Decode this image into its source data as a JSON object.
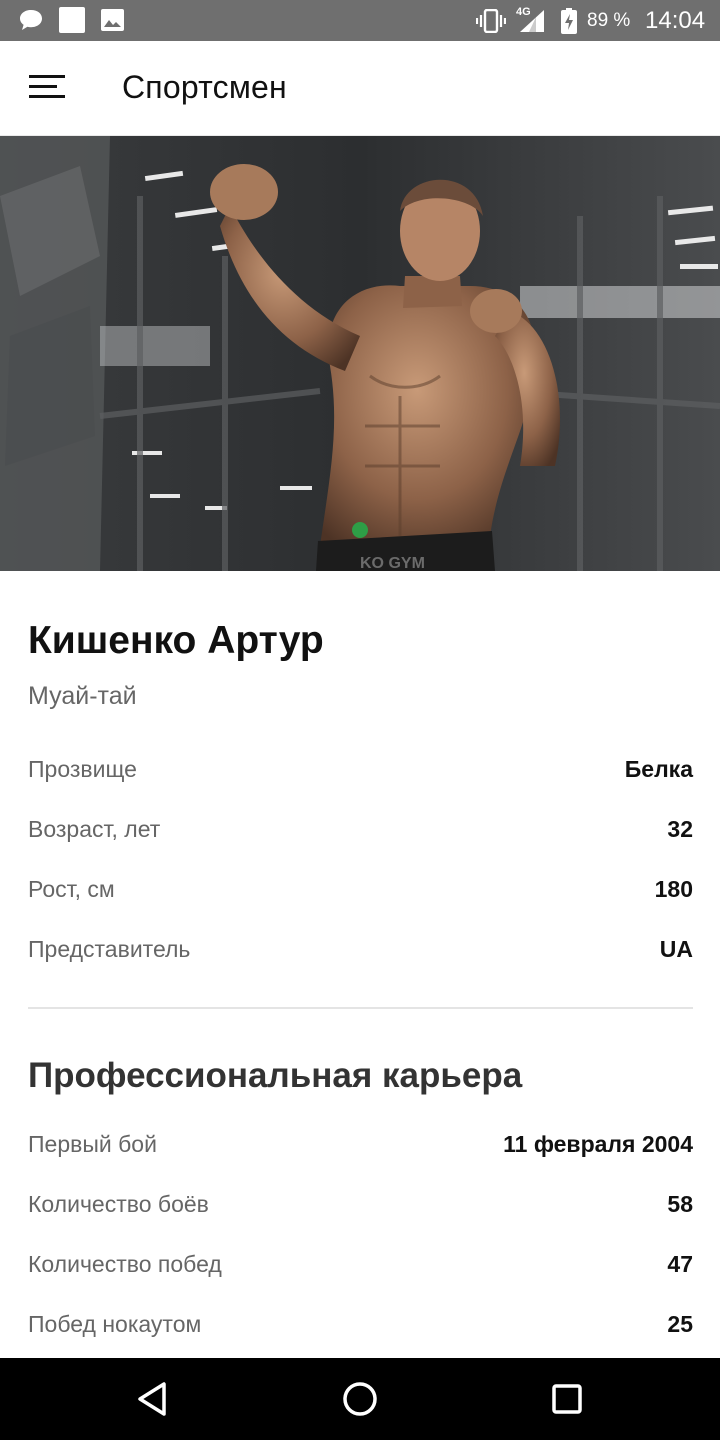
{
  "status_bar": {
    "battery_percent": "89 %",
    "time": "14:04",
    "network": "4G",
    "icons": [
      "chat-bubble-icon",
      "blank-notification-icon",
      "image-icon",
      "vibrate-icon",
      "signal-icon",
      "battery-charging-icon"
    ]
  },
  "app_bar": {
    "title": "Спортсмен",
    "menu_icon": "menu-icon"
  },
  "hero": {
    "carousel_indicator_color": "#2e9e46",
    "shorts_text": "KO GYM"
  },
  "athlete": {
    "name": "Кишенко Артур",
    "sport": "Муай-тай",
    "details": [
      {
        "label": "Прозвище",
        "value": "Белка"
      },
      {
        "label": "Возраст, лет",
        "value": "32"
      },
      {
        "label": "Рост, см",
        "value": "180"
      },
      {
        "label": "Представитель",
        "value": "UA"
      }
    ]
  },
  "career": {
    "title": "Профессиональная карьера",
    "stats": [
      {
        "label": "Первый бой",
        "value": "11 февраля 2004"
      },
      {
        "label": "Количество боёв",
        "value": "58"
      },
      {
        "label": "Количество побед",
        "value": "47"
      },
      {
        "label": "Побед нокаутом",
        "value": "25"
      }
    ]
  },
  "nav_bar": {
    "buttons": [
      "back-icon",
      "home-icon",
      "recents-icon"
    ]
  },
  "colors": {
    "status_bar": "#6f6f6f",
    "accent_green": "#2e9e46",
    "label_gray": "#666666",
    "value_black": "#111111"
  }
}
